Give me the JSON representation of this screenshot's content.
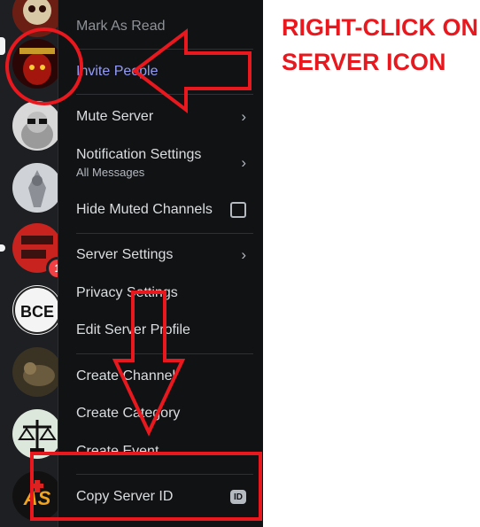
{
  "menu": {
    "mark_as_read": "Mark As Read",
    "invite_people": "Invite People",
    "mute_server": "Mute Server",
    "notification_settings": "Notification Settings",
    "notification_settings_sub": "All Messages",
    "hide_muted_channels": "Hide Muted Channels",
    "server_settings": "Server Settings",
    "privacy_settings": "Privacy Settings",
    "edit_server_profile": "Edit Server Profile",
    "create_channel": "Create Channel",
    "create_category": "Create Category",
    "create_event": "Create Event",
    "copy_server_id": "Copy Server ID",
    "id_badge": "ID",
    "chevron": "›"
  },
  "rail": {
    "mention_count": "1",
    "server_icons": [
      "skull-server-icon",
      "diablo-server-icon",
      "sunglasses-server-icon",
      "sketch-server-icon",
      "red-server-icon",
      "bce-server-icon",
      "bird-server-icon",
      "scales-server-icon",
      "as-server-icon"
    ]
  },
  "annotation": {
    "instruction": "RIGHT-CLICK ON SERVER ICON"
  },
  "colors": {
    "annotation_red": "#e8181e",
    "menu_bg": "#111214",
    "rail_bg": "#1e1f22",
    "invite_text": "#949cf7",
    "menu_text": "#dbdee1"
  }
}
